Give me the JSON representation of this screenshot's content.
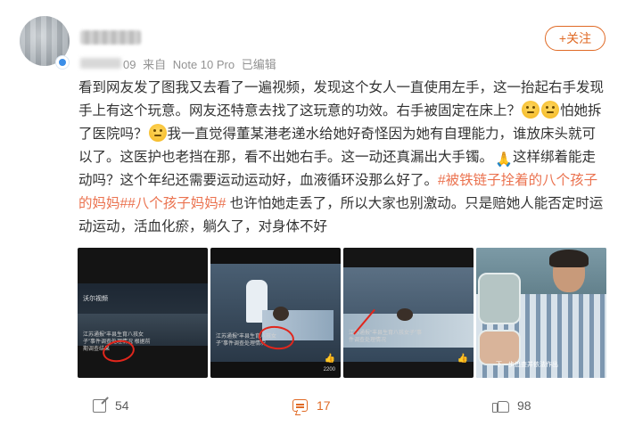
{
  "post": {
    "source_prefix": "来自",
    "device": "Note 10 Pro",
    "edited": "已编辑",
    "time_fragment": "09",
    "follow_label": "+关注",
    "text_parts": [
      "看到网友发了图我又去看了一遍视频，发现这个女人一直使用左手，这一抬起右手发现手上有这个玩意。网友还特意去找了这玩意的功效。右手被固定在床上？",
      "怕她拆了医院吗？",
      "我一直觉得董某港老递水给她好奇怪因为她有自理能力，谁放床头就可以了。这医护也老挡在那，看不出她右手。这一动还真漏出大手镯。",
      "这样绑着能走动吗？这个年纪还需要运动运动好，血液循环没那么好了。",
      "也许怕她走丢了，所以大家也别激动。只是赔她人能否定时运动运动，活血化瘀，躺久了，对身体不好"
    ],
    "tags": [
      "#被铁链子拴着的八个孩子的妈妈#",
      "#八个孩子妈妈#"
    ]
  },
  "thumbnails": [
    {
      "label": "沃尔视频",
      "caption": "江苏通报“丰县生育八孩女子”事件调查处理情况 根据前期调查结果",
      "icon": "video-thumb"
    },
    {
      "label": "",
      "caption": "江苏通报“丰县生育八孩女子”事件调查处理情况",
      "like_mark": "👍",
      "count": "2200"
    },
    {
      "label": "",
      "caption": "江苏通报“丰县生育八孩女子”事件调查处理情况",
      "like_mark": "👍"
    },
    {
      "label": "",
      "caption": "下一步追查并依法作出",
      "icon": "collage-thumb"
    }
  ],
  "footer": {
    "share_count": "54",
    "comment_count": "17",
    "like_count": "98"
  },
  "colors": {
    "accent": "#e06a25",
    "tag": "#eb7350",
    "annotation_red": "#e1261c"
  }
}
